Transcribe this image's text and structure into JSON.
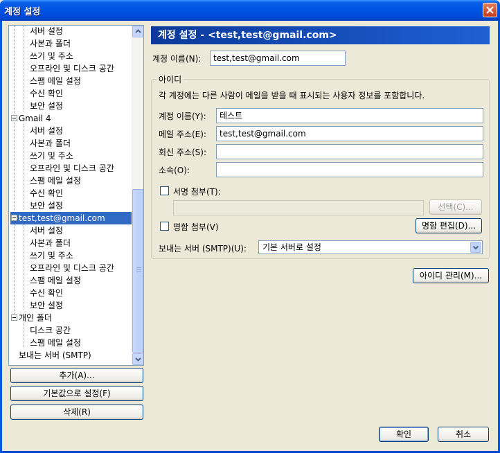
{
  "window": {
    "title": "계정 설정"
  },
  "tree": {
    "account1_children": [
      "서버 설정",
      "사본과 폴더",
      "쓰기 및 주소",
      "오프라인 및 디스크 공간",
      "스팸 메일 설정",
      "수신 확인",
      "보안 설정"
    ],
    "account2": {
      "label": "Gmail 4",
      "children": [
        "서버 설정",
        "사본과 폴더",
        "쓰기 및 주소",
        "오프라인 및 디스크 공간",
        "스팸 메일 설정",
        "수신 확인",
        "보안 설정"
      ]
    },
    "account3": {
      "label": "test,test@gmail.com",
      "children": [
        "서버 설정",
        "사본과 폴더",
        "쓰기 및 주소",
        "오프라인 및 디스크 공간",
        "스팸 메일 설정",
        "수신 확인",
        "보안 설정"
      ]
    },
    "local": {
      "label": "개인 폴더",
      "children": [
        "디스크 공간",
        "스팸 메일 설정"
      ]
    },
    "smtp": "보내는 서버 (SMTP)"
  },
  "left_buttons": {
    "add": "추가(A)...",
    "set_default": "기본값으로 설정(F)",
    "delete": "삭제(R)"
  },
  "header": "계정 설정 - <test,test@gmail.com>",
  "account_name": {
    "label": "계정 이름(N):",
    "value": "test,test@gmail.com"
  },
  "identity": {
    "title": "아이디",
    "description": "각 계정에는 다른 사람이 메일을 받을 때 표시되는 사용자 정보를 포함합니다.",
    "name_label": "계정 이름(Y):",
    "name_value": "테스트",
    "email_label": "메일 주소(E):",
    "email_value": "test,test@gmail.com",
    "reply_label": "회신 주소(S):",
    "reply_value": "",
    "org_label": "소속(O):",
    "org_value": "",
    "signature_label": "서명 첨부(T):",
    "signature_path": "",
    "choose_button": "선택(C)...",
    "vcard_label": "명함 첨부(V)",
    "edit_card_button": "명함 편집(D)...",
    "smtp_label": "보내는 서버 (SMTP)(U):",
    "smtp_value": "기본 서버로 설정"
  },
  "manage_identities_button": "아이디 관리(M)...",
  "footer": {
    "ok": "확인",
    "cancel": "취소"
  }
}
